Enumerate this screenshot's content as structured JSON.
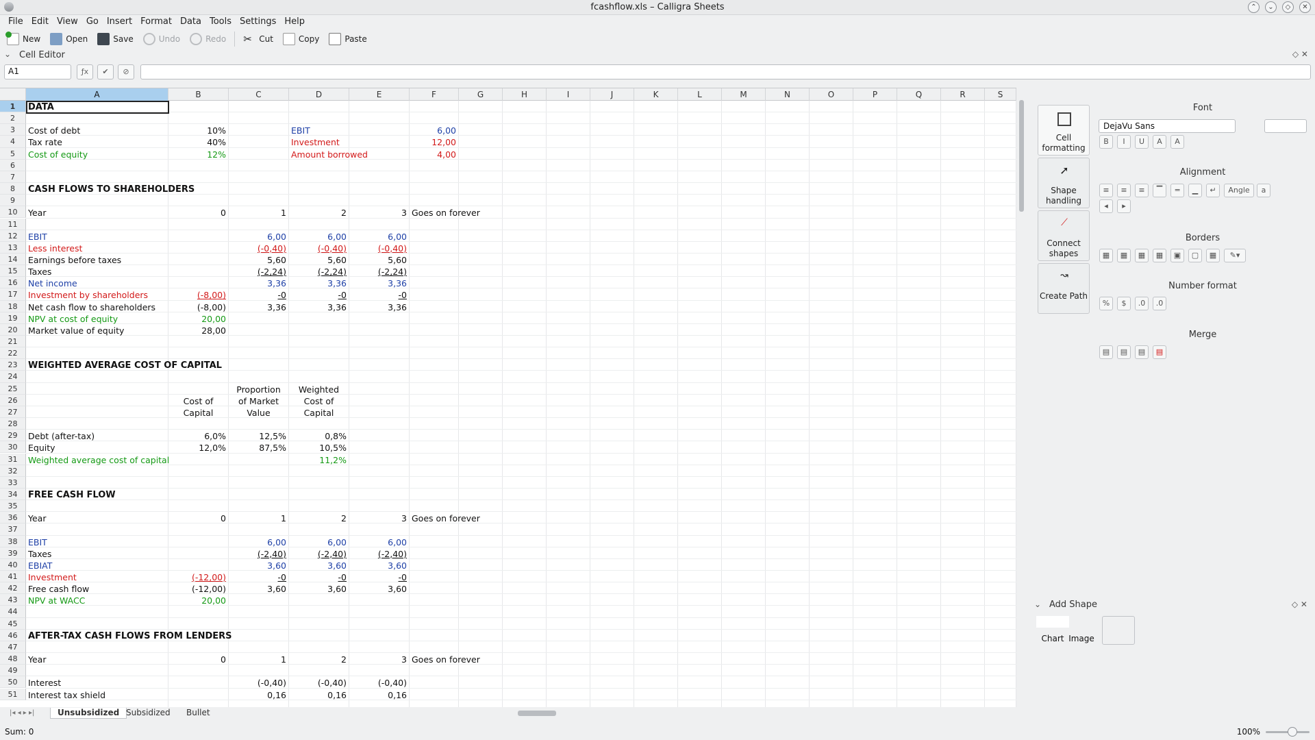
{
  "window": {
    "title": "fcashflow.xls – Calligra Sheets"
  },
  "menu": [
    "File",
    "Edit",
    "View",
    "Go",
    "Insert",
    "Format",
    "Data",
    "Tools",
    "Settings",
    "Help"
  ],
  "toolbar": {
    "new": "New",
    "open": "Open",
    "save": "Save",
    "undo": "Undo",
    "redo": "Redo",
    "cut": "Cut",
    "copy": "Copy",
    "paste": "Paste"
  },
  "cell_editor": {
    "label": "Cell Editor",
    "cell_ref": "A1",
    "formula": ""
  },
  "columns": [
    "A",
    "B",
    "C",
    "D",
    "E",
    "F",
    "G",
    "H",
    "I",
    "J",
    "K",
    "L",
    "M",
    "N",
    "O",
    "P",
    "Q",
    "R",
    "S"
  ],
  "rows": [
    1,
    2,
    3,
    4,
    5,
    6,
    7,
    8,
    9,
    10,
    11,
    12,
    13,
    14,
    15,
    16,
    17,
    18,
    19,
    20,
    21,
    22,
    23,
    24,
    25,
    26,
    27,
    28,
    29,
    30,
    31,
    32,
    33,
    34,
    35,
    36,
    37,
    38,
    39,
    40,
    41,
    42,
    43,
    44,
    45,
    46,
    47,
    48,
    49,
    50,
    51
  ],
  "cells": {
    "data_title": "DATA",
    "cost_of_debt": "Cost of debt",
    "cost_of_debt_v": "10%",
    "tax_rate": "Tax rate",
    "tax_rate_v": "40%",
    "cost_of_equity": "Cost of equity",
    "cost_of_equity_v": "12%",
    "ebit_lbl": "EBIT",
    "ebit_v": "6,00",
    "investment_lbl": "Investment",
    "investment_v": "12,00",
    "amount_borrowed": "Amount borrowed",
    "amount_borrowed_v": "4,00",
    "cfs_title": "CASH FLOWS TO SHAREHOLDERS",
    "year": "Year",
    "y0": "0",
    "y1": "1",
    "y2": "2",
    "y3": "3",
    "forever": "Goes on forever",
    "ebit_row": "EBIT",
    "v600": "6,00",
    "less_interest": "Less interest",
    "v040": "(-0,40)",
    "ebt": "Earnings before taxes",
    "v560": "5,60",
    "taxes": "Taxes",
    "v224": "(-2,24)",
    "net_income": "Net income",
    "v336": "3,36",
    "inv_shareholders": "Investment by shareholders",
    "v800": "(-8,00)",
    "v0": "-0",
    "ncf_shareholders": "Net cash flow to shareholders",
    "npv_coe": "NPV at cost of equity",
    "v2000": "20,00",
    "mve": "Market value of equity",
    "v2800": "28,00",
    "wacc_title": "WEIGHTED AVERAGE COST OF CAPITAL",
    "prop_h1": "Proportion",
    "prop_h2": "of Market",
    "prop_h3": "Value",
    "w_h1": "Weighted",
    "w_h2": "Cost of",
    "w_h3": "Capital",
    "coc_h1": "Cost of",
    "coc_h2": "Capital",
    "debt_at": "Debt (after-tax)",
    "debt_coc": "6,0%",
    "debt_prop": "12,5%",
    "debt_w": "0,8%",
    "equity": "Equity",
    "eq_coc": "12,0%",
    "eq_prop": "87,5%",
    "eq_w": "10,5%",
    "wacc": "Weighted average cost of capital",
    "wacc_v": "11,2%",
    "fcf_title": "FREE CASH FLOW",
    "taxes2_v": "(-2,40)",
    "ebiat": "EBIAT",
    "v360": "3,60",
    "investment2": "Investment",
    "v1200": "(-12,00)",
    "fcf": "Free cash flow",
    "npv_wacc": "NPV at WACC",
    "atcfl_title": "AFTER-TAX CASH FLOWS FROM LENDERS",
    "interest": "Interest",
    "its": "Interest tax shield",
    "v016": "0,16"
  },
  "sheet_tabs": [
    "Unsubsidized",
    "Subsidized",
    "Bullet"
  ],
  "dock": {
    "tools": [
      "Cell formatting",
      "Shape handling",
      "Connect shapes",
      "Create Path"
    ],
    "font_section": "Font",
    "font_name": "DejaVu Sans",
    "alignment": "Alignment",
    "angle": "Angle",
    "borders": "Borders",
    "number_format": "Number format",
    "merge": "Merge",
    "add_shape": "Add Shape",
    "chart": "Chart",
    "image": "Image"
  },
  "status": {
    "sum": "Sum: 0",
    "zoom": "100%"
  },
  "colors": {
    "red": "#d21919",
    "blue": "#1d3fa6",
    "green": "#149914",
    "selection": "#a9cfee"
  }
}
